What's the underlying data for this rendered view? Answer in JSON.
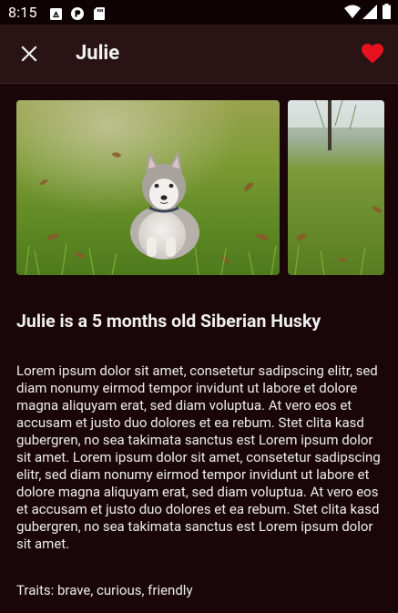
{
  "status_bar": {
    "time": "8:15",
    "notification_icons": [
      "newspaper-icon",
      "pocket-casts-icon",
      "sd-card-icon"
    ],
    "system_icons": [
      "wifi-icon",
      "signal-icon",
      "battery-icon"
    ]
  },
  "app_bar": {
    "title": "Julie",
    "close_icon": "close-icon",
    "favorite_icon": "heart-icon",
    "favorite_color": "#e8111e"
  },
  "gallery": {
    "photos": [
      {
        "subject": "husky puppy sitting on grass"
      },
      {
        "subject": "grass field with tree"
      }
    ]
  },
  "details": {
    "headline": "Julie is a 5 months old Siberian Husky",
    "description": "Lorem ipsum dolor sit amet, consetetur sadipscing elitr, sed diam nonumy eirmod tempor invidunt ut labore et dolore magna aliquyam erat, sed diam voluptua. At vero eos et accusam et justo duo dolores et ea rebum. Stet clita kasd gubergren, no sea takimata sanctus est Lorem ipsum dolor sit amet. Lorem ipsum dolor sit amet, consetetur sadipscing elitr, sed diam nonumy eirmod tempor invidunt ut labore et dolore magna aliquyam erat, sed diam voluptua. At vero eos et accusam et justo duo dolores et ea rebum. Stet clita kasd gubergren, no sea takimata sanctus est Lorem ipsum dolor sit amet.",
    "traits": "Traits: brave, curious, friendly"
  },
  "colors": {
    "background": "#1a0608",
    "app_bar": "#2a1315",
    "status_bar": "#0f0204",
    "text": "#ececec"
  }
}
